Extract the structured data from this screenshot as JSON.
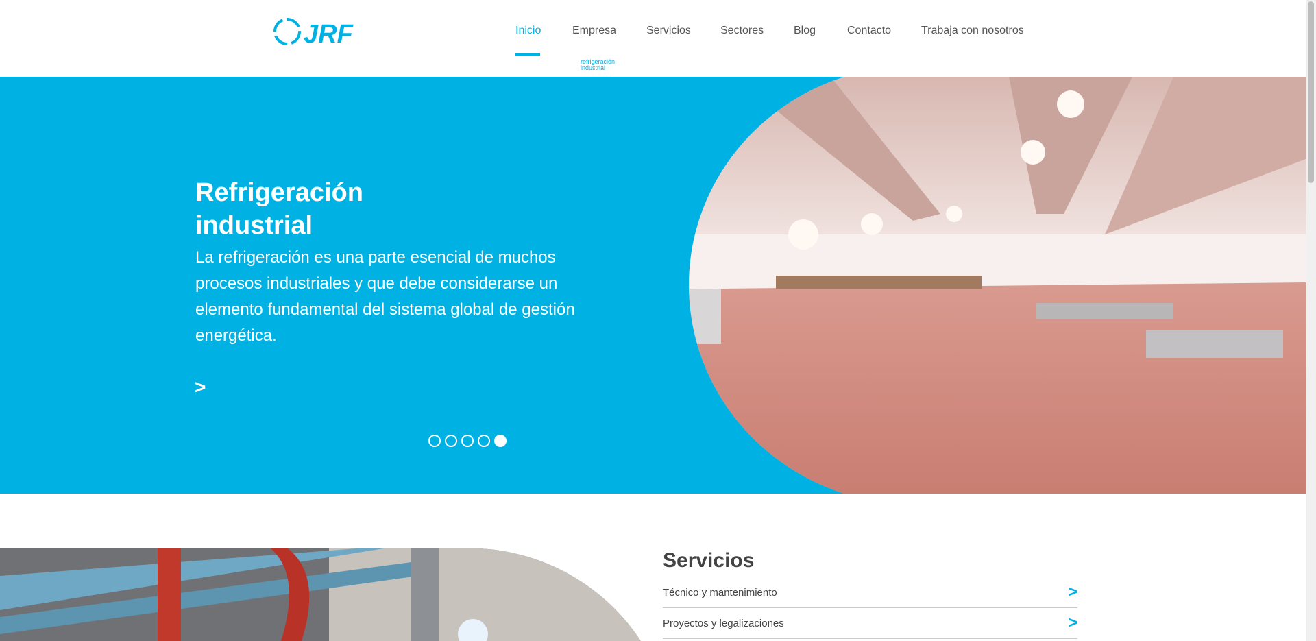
{
  "header": {
    "logo_text": "JRF",
    "logo_tagline_1": "refrigeración",
    "logo_tagline_2": "industrial",
    "nav": [
      {
        "label": "Inicio",
        "active": true
      },
      {
        "label": "Empresa"
      },
      {
        "label": "Servicios"
      },
      {
        "label": "Sectores"
      },
      {
        "label": "Blog"
      },
      {
        "label": "Contacto"
      },
      {
        "label": "Trabaja con nosotros"
      }
    ]
  },
  "hero": {
    "title_line1": "Refrigeración",
    "title_line2": "industrial",
    "text": "La refrigeración es una parte esencial de muchos procesos industriales y que debe considerarse un elemento fundamental del sistema global de gestión energética.",
    "arrow": ">",
    "slides_total": 5,
    "slide_active": 5
  },
  "services": {
    "title": "Servicios",
    "items": [
      {
        "label": "Técnico y mantenimiento",
        "arrow": ">"
      },
      {
        "label": "Proyectos y legalizaciones",
        "arrow": ">"
      }
    ]
  },
  "colors": {
    "accent": "#00b2e3",
    "text": "#555555"
  }
}
